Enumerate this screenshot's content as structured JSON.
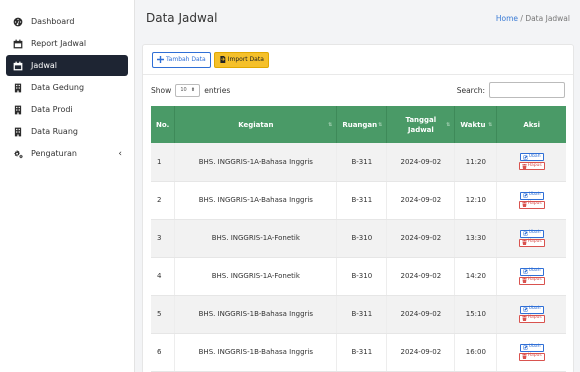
{
  "sidebar": {
    "items": [
      {
        "label": "Dashboard",
        "icon": "dashboard-icon"
      },
      {
        "label": "Report Jadwal",
        "icon": "calendar-icon"
      },
      {
        "label": "Jadwal",
        "icon": "calendar-icon",
        "active": true
      },
      {
        "label": "Data Gedung",
        "icon": "building-icon"
      },
      {
        "label": "Data Prodi",
        "icon": "building-icon"
      },
      {
        "label": "Data Ruang",
        "icon": "building-icon"
      },
      {
        "label": "Pengaturan",
        "icon": "gears-icon"
      }
    ],
    "chevron": "‹"
  },
  "header": {
    "title": "Data Jadwal",
    "breadcrumb_home": "Home",
    "breadcrumb_sep": "/",
    "breadcrumb_current": "Data Jadwal"
  },
  "toolbar": {
    "add_label": "Tambah Data",
    "import_label": "Import Data"
  },
  "controls": {
    "show_label": "Show",
    "entries_value": "10",
    "entries_label": "entries",
    "search_label": "Search:"
  },
  "table": {
    "headers": {
      "no": "No.",
      "kegiatan": "Kegiatan",
      "ruangan": "Ruangan",
      "tanggal_1": "Tanggal",
      "tanggal_2": "Jadwal",
      "waktu": "Waktu",
      "aksi": "Aksi"
    },
    "edit_label": "Ubah",
    "delete_label": "Hapus",
    "rows": [
      {
        "no": "1",
        "kegiatan": "BHS. INGGRIS-1A-Bahasa Inggris",
        "ruangan": "B-311",
        "tanggal": "2024-09-02",
        "waktu": "11:20"
      },
      {
        "no": "2",
        "kegiatan": "BHS. INGGRIS-1A-Bahasa Inggris",
        "ruangan": "B-311",
        "tanggal": "2024-09-02",
        "waktu": "12:10"
      },
      {
        "no": "3",
        "kegiatan": "BHS. INGGRIS-1A-Fonetik",
        "ruangan": "B-310",
        "tanggal": "2024-09-02",
        "waktu": "13:30"
      },
      {
        "no": "4",
        "kegiatan": "BHS. INGGRIS-1A-Fonetik",
        "ruangan": "B-310",
        "tanggal": "2024-09-02",
        "waktu": "14:20"
      },
      {
        "no": "5",
        "kegiatan": "BHS. INGGRIS-1B-Bahasa Inggris",
        "ruangan": "B-311",
        "tanggal": "2024-09-02",
        "waktu": "15:10"
      },
      {
        "no": "6",
        "kegiatan": "BHS. INGGRIS-1B-Bahasa Inggris",
        "ruangan": "B-311",
        "tanggal": "2024-09-02",
        "waktu": "16:00"
      }
    ]
  },
  "colors": {
    "header_green": "#4a9a67",
    "sidebar_active": "#1e2533",
    "primary_blue": "#2f6fd6",
    "warning_yellow": "#f5c02a",
    "danger_red": "#d9534f"
  }
}
